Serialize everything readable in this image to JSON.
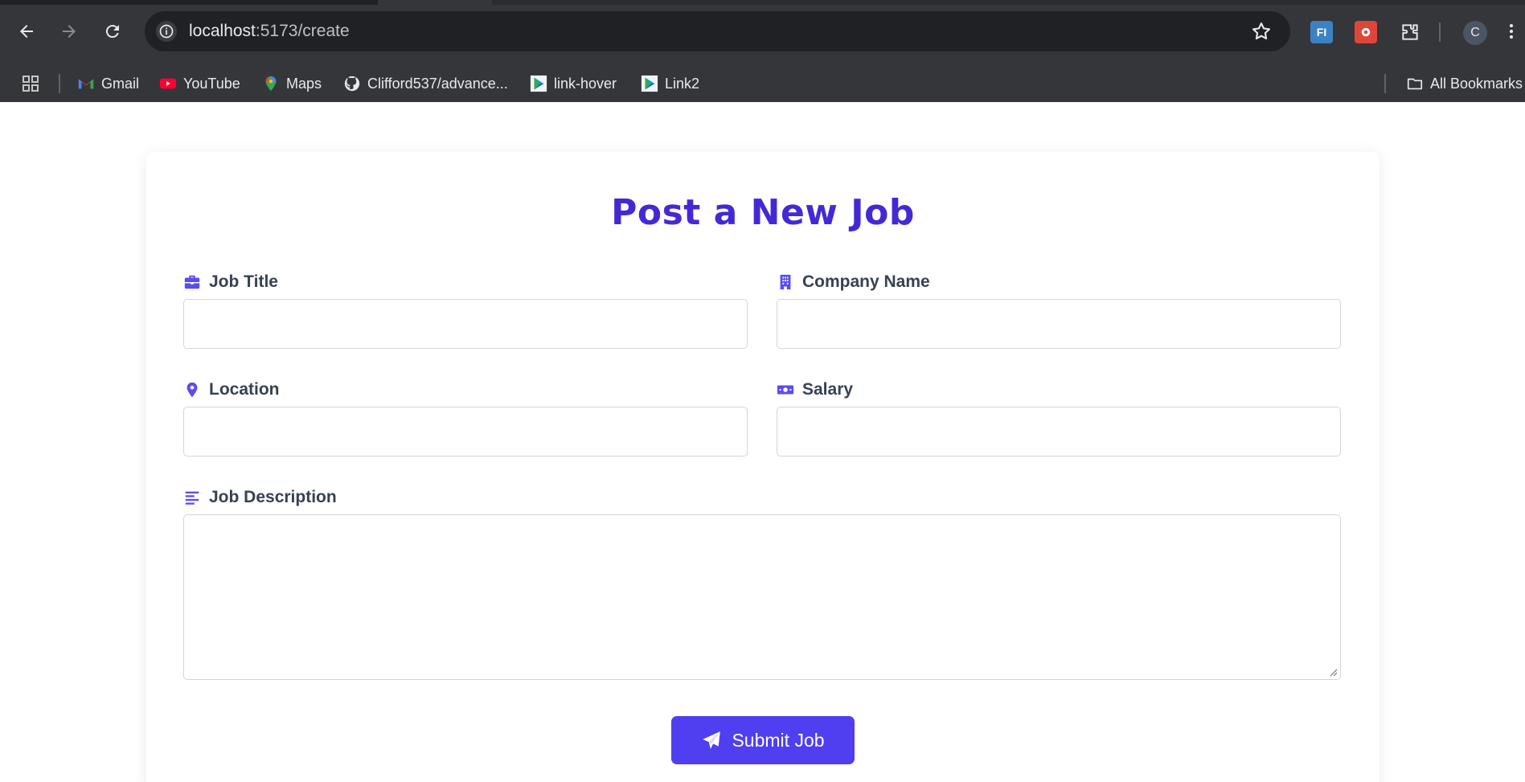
{
  "browser": {
    "url_host": "localhost",
    "url_path": ":5173/create",
    "profile_initial": "C",
    "extensions": [
      {
        "name": "fi-extension-icon",
        "label": "FI",
        "color": "#3b82c4"
      },
      {
        "name": "puzzle-red-extension-icon",
        "label": "",
        "color": "#e0453a"
      }
    ],
    "bookmarks": [
      {
        "name": "bookmark-gmail",
        "label": "Gmail",
        "icon": "gmail-icon"
      },
      {
        "name": "bookmark-youtube",
        "label": "YouTube",
        "icon": "youtube-icon"
      },
      {
        "name": "bookmark-maps",
        "label": "Maps",
        "icon": "maps-icon"
      },
      {
        "name": "bookmark-github",
        "label": "Clifford537/advance...",
        "icon": "github-icon"
      },
      {
        "name": "bookmark-link-hover",
        "label": "link-hover",
        "icon": "play-logo-icon"
      },
      {
        "name": "bookmark-link2",
        "label": "Link2",
        "icon": "play-logo-icon"
      }
    ],
    "all_bookmarks_label": "All Bookmarks"
  },
  "form": {
    "title": "Post a New Job",
    "accent_color": "#4f3ff0",
    "fields": {
      "job_title": {
        "label": "Job Title",
        "icon": "briefcase-icon",
        "value": ""
      },
      "company_name": {
        "label": "Company Name",
        "icon": "building-icon",
        "value": ""
      },
      "location": {
        "label": "Location",
        "icon": "map-pin-icon",
        "value": ""
      },
      "salary": {
        "label": "Salary",
        "icon": "money-bill-icon",
        "value": ""
      },
      "job_description": {
        "label": "Job Description",
        "icon": "align-left-icon",
        "value": ""
      }
    },
    "submit_label": "Submit Job"
  }
}
